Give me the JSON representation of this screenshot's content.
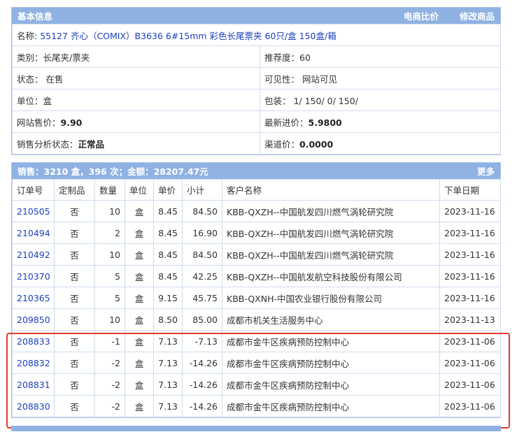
{
  "basic": {
    "title": "基本信息",
    "compare": "电商比价",
    "edit": "修改商品",
    "name_label": "名称:",
    "name_value": "55127 齐心（COMIX）B3636 6#15mm 彩色长尾票夹 60只/盒 150盒/箱",
    "category": "类别：长尾夹/票夹",
    "recommend": "推荐度：60",
    "status": "状态：  在售",
    "visibility": "可见性：  网站可见",
    "unit": "单位：盒",
    "packaging": "包装：  1/ 150/ 0/ 150/",
    "site_price_label": "网站售价：",
    "site_price": "9.90",
    "latest_cost_label": "最新进价：",
    "latest_cost": "5.9800",
    "sales_status_label": "销售分析状态：",
    "sales_status": "正常品",
    "channel_label": "渠道价：",
    "channel_price": "0.0000"
  },
  "sales": {
    "summary": "销售：3210 盒，396 次；金额：28207.47元",
    "more": "更多",
    "headers": [
      "订单号",
      "定制品",
      "数量",
      "单位",
      "单价",
      "小计",
      "客户名称",
      "下单日期"
    ],
    "rows": [
      [
        "210505",
        "否",
        "10",
        "盒",
        "8.45",
        "84.50",
        "KBB-QXZH--中国航发四川燃气涡轮研究院",
        "2023-11-16"
      ],
      [
        "210494",
        "否",
        "2",
        "盒",
        "8.45",
        "16.90",
        "KBB-QXZH--中国航发四川燃气涡轮研究院",
        "2023-11-16"
      ],
      [
        "210492",
        "否",
        "10",
        "盒",
        "8.45",
        "84.50",
        "KBB-QXZH--中国航发四川燃气涡轮研究院",
        "2023-11-16"
      ],
      [
        "210370",
        "否",
        "5",
        "盒",
        "8.45",
        "42.25",
        "KBB-QXZH--中国航发航空科技股份有限公司",
        "2023-11-16"
      ],
      [
        "210365",
        "否",
        "5",
        "盒",
        "9.15",
        "45.75",
        "KBB-QXNH-中国农业银行股份有限公司",
        "2023-11-16"
      ],
      [
        "209850",
        "否",
        "10",
        "盒",
        "8.50",
        "85.00",
        "成都市机关生活服务中心",
        "2023-11-13"
      ],
      [
        "208833",
        "否",
        "-1",
        "盒",
        "7.13",
        "-7.13",
        "成都市金牛区疾病预防控制中心",
        "2023-11-06"
      ],
      [
        "208832",
        "否",
        "-2",
        "盒",
        "7.13",
        "-14.26",
        "成都市金牛区疾病预防控制中心",
        "2023-11-06"
      ],
      [
        "208831",
        "否",
        "-2",
        "盒",
        "7.13",
        "-14.26",
        "成都市金牛区疾病预防控制中心",
        "2023-11-06"
      ],
      [
        "208830",
        "否",
        "-2",
        "盒",
        "7.13",
        "-14.26",
        "成都市金牛区疾病预防控制中心",
        "2023-11-06"
      ]
    ]
  }
}
